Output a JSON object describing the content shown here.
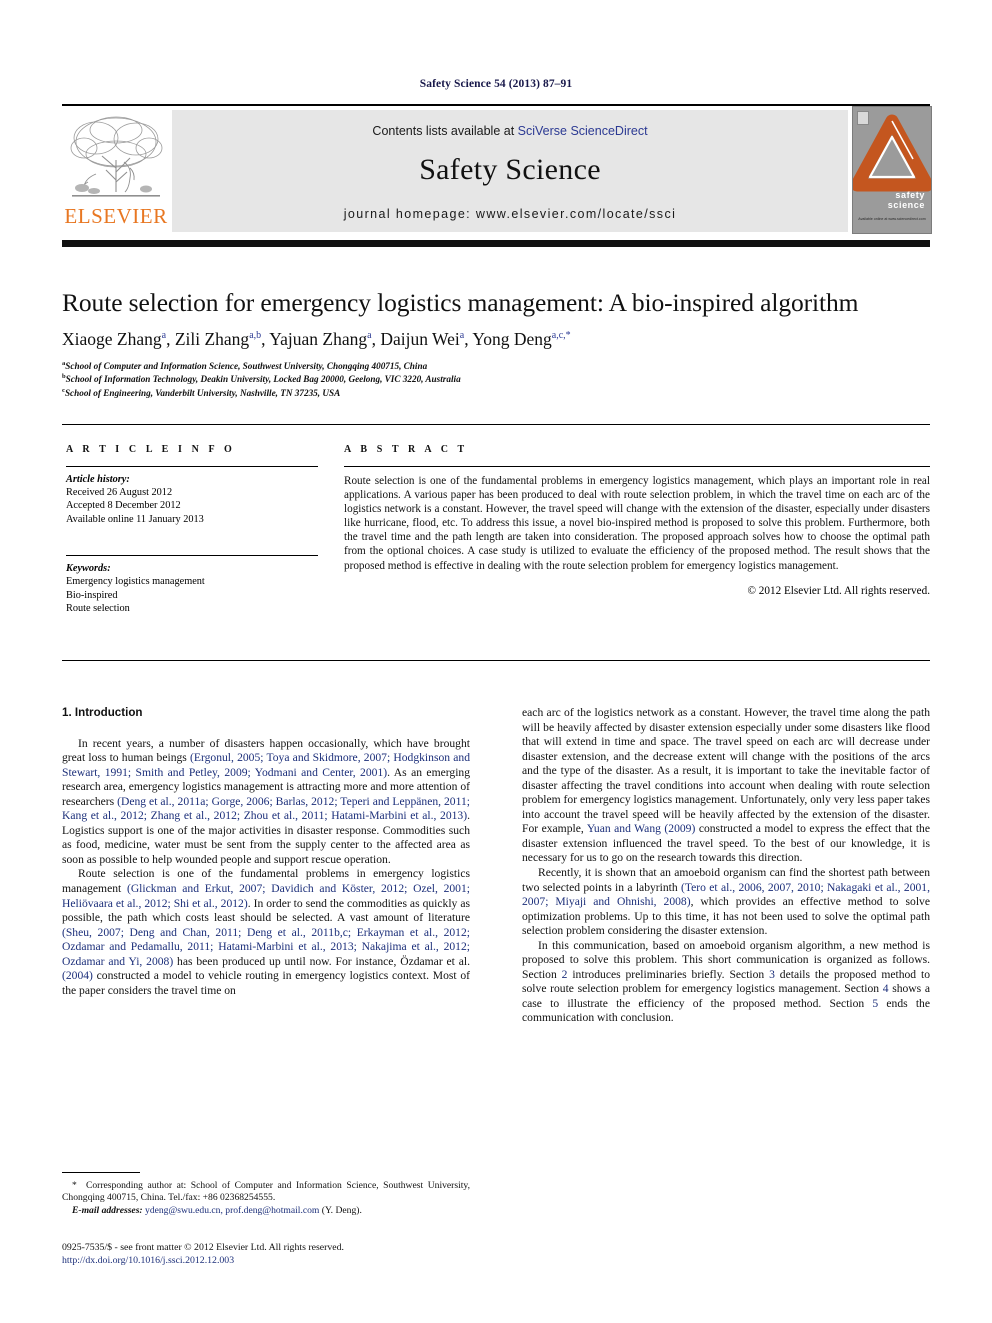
{
  "running_head": "Safety Science 54 (2013) 87–91",
  "masthead": {
    "contents_prefix": "Contents lists available at ",
    "sciencedirect": "SciVerse ScienceDirect",
    "journal_title": "Safety Science",
    "homepage": "journal homepage: www.elsevier.com/locate/ssci",
    "publisher_wordmark": "ELSEVIER",
    "publisher_logo_icon": "elsevier-tree-icon",
    "cover": {
      "line1": "safety",
      "line2": "science",
      "footer": "Available online at www.sciencedirect.com"
    }
  },
  "article": {
    "title": "Route selection for emergency logistics management: A bio-inspired algorithm",
    "authors": [
      {
        "name": "Xiaoge Zhang",
        "sup": "a",
        "sep": ", "
      },
      {
        "name": "Zili Zhang",
        "sup": "a,b",
        "sep": ", "
      },
      {
        "name": "Yajuan Zhang",
        "sup": "a",
        "sep": ", "
      },
      {
        "name": "Daijun Wei",
        "sup": "a",
        "sep": ", "
      },
      {
        "name": "Yong Deng",
        "sup": "a,c,*",
        "sep": ""
      }
    ],
    "affiliations": [
      {
        "label": "a",
        "text": "School of Computer and Information Science, Southwest University, Chongqing 400715, China"
      },
      {
        "label": "b",
        "text": "School of Information Technology, Deakin University, Locked Bag 20000, Geelong, VIC 3220, Australia"
      },
      {
        "label": "c",
        "text": "School of Engineering, Vanderbilt University, Nashville, TN 37235, USA"
      }
    ]
  },
  "article_info": {
    "heading": "A R T I C L E   I N F O",
    "history_label": "Article history:",
    "history": [
      "Received 26 August 2012",
      "Accepted 8 December 2012",
      "Available online 11 January 2013"
    ],
    "keywords_label": "Keywords:",
    "keywords": [
      "Emergency logistics management",
      "Bio-inspired",
      "Route selection"
    ]
  },
  "abstract": {
    "heading": "A B S T R A C T",
    "body": "Route selection is one of the fundamental problems in emergency logistics management, which plays an important role in real applications. A various paper has been produced to deal with route selection problem, in which the travel time on each arc of the logistics network is a constant. However, the travel speed will change with the extension of the disaster, especially under disasters like hurricane, flood, etc. To address this issue, a novel bio-inspired method is proposed to solve this problem. Furthermore, both the travel time and the path length are taken into consideration. The proposed approach solves how to choose the optimal path from the optional choices. A case study is utilized to evaluate the efficiency of the proposed method. The result shows that the proposed method is effective in dealing with the route selection problem for emergency logistics management.",
    "copyright": "© 2012 Elsevier Ltd. All rights reserved."
  },
  "body": {
    "section_title": "1. Introduction",
    "left_paragraphs": [
      "In recent years, a number of disasters happen occasionally, which have brought great loss to human beings (Ergonul, 2005; Toya and Skidmore, 2007; Hodgkinson and Stewart, 1991; Smith and Petley, 2009; Yodmani and Center, 2001). As an emerging research area, emergency logistics management is attracting more and more attention of researchers (Deng et al., 2011a; Gorge, 2006; Barlas, 2012; Teperi and Leppänen, 2011; Kang et al., 2012; Zhang et al., 2012; Zhou et al., 2011; Hatami-Marbini et al., 2013). Logistics support is one of the major activities in disaster response. Commodities such as food, medicine, water must be sent from the supply center to the affected area as soon as possible to help wounded people and support rescue operation.",
      "Route selection is one of the fundamental problems in emergency logistics management (Glickman and Erkut, 2007; Davidich and Köster, 2012; Ozel, 2001; Heliövaara et al., 2012; Shi et al., 2012). In order to send the commodities as quickly as possible, the path which costs least should be selected. A vast amount of literature (Sheu, 2007; Deng and Chan, 2011; Deng et al., 2011b,c; Erkayman et al., 2012; Ozdamar and Pedamallu, 2011; Hatami-Marbini et al., 2013; Nakajima et al., 2012; Ozdamar and Yi, 2008) has been produced up until now. For instance, Özdamar et al. (2004) constructed a model to vehicle routing in emergency logistics context. Most of the paper considers the travel time on"
    ],
    "right_paragraphs": [
      "each arc of the logistics network as a constant. However, the travel time along the path will be heavily affected by disaster extension especially under some disasters like flood that will extend in time and space. The travel speed on each arc will decrease under disaster extension, and the decrease extent will change with the positions of the arcs and the type of the disaster. As a result, it is important to take the inevitable factor of disaster affecting the travel conditions into account when dealing with route selection problem for emergency logistics management. Unfortunately, only very less paper takes into account the travel speed will be heavily affected by the extension of the disaster. For example, Yuan and Wang (2009) constructed a model to express the effect that the disaster extension influenced the travel speed. To the best of our knowledge, it is necessary for us to go on the research towards this direction.",
      "Recently, it is shown that an amoeboid organism can find the shortest path between two selected points in a labyrinth (Tero et al., 2006, 2007, 2010; Nakagaki et al., 2001, 2007; Miyaji and Ohnishi, 2008), which provides an effective method to solve optimization problems. Up to this time, it has not been used to solve the optimal path selection problem considering the disaster extension.",
      "In this communication, based on amoeboid organism algorithm, a new method is proposed to solve this problem. This short communication is organized as follows. Section 2 introduces preliminaries briefly. Section 3 details the proposed method to solve route selection problem for emergency logistics management. Section 4 shows a case to illustrate the efficiency of the proposed method. Section 5 ends the communication with conclusion."
    ]
  },
  "footnotes": {
    "corresponding_marker": "*",
    "corresponding": "Corresponding author at: School of Computer and Information Science, Southwest University, Chongqing 400715, China. Tel./fax: +86 02368254555.",
    "email_label": "E-mail addresses:",
    "emails": "ydeng@swu.edu.cn, prof.deng@hotmail.com",
    "email_owner": "(Y. Deng)."
  },
  "imprint": {
    "issn_line": "0925-7535/$ - see front matter © 2012 Elsevier Ltd. All rights reserved.",
    "doi": "http://dx.doi.org/10.1016/j.ssci.2012.12.003"
  },
  "colors": {
    "link_blue": "#2c3a93",
    "reference_blue": "#1c2f7a",
    "elsevier_orange": "#E87722",
    "banner_gray": "#e6e6e6"
  }
}
